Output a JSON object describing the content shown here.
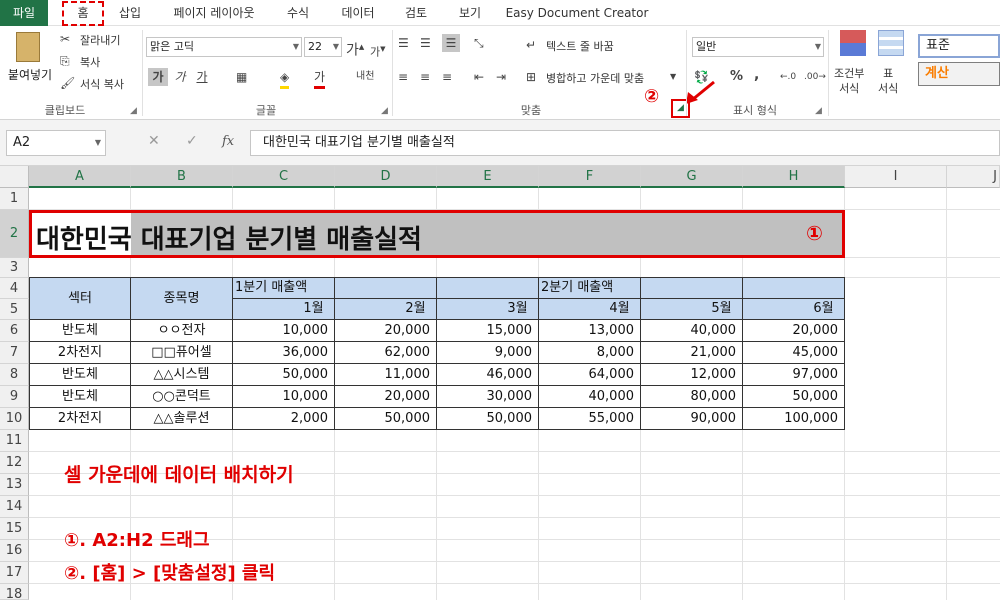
{
  "menu": {
    "tabs": [
      "파일",
      "홈",
      "삽입",
      "페이지 레이아웃",
      "수식",
      "데이터",
      "검토",
      "보기",
      "Easy Document Creator"
    ]
  },
  "ribbon": {
    "clipboard": {
      "paste": "붙여넣기",
      "cut": "잘라내기",
      "copy": "복사",
      "format_painter": "서식 복사",
      "label": "클립보드"
    },
    "font": {
      "name": "맑은 고딕",
      "size": "22",
      "bold": "가",
      "italic": "가",
      "underline": "가",
      "label": "글꼴",
      "font_color_icon": "가",
      "phonetic": "내천"
    },
    "alignment": {
      "wrap_text": "텍스트 줄 바꿈",
      "merge_center": "병합하고 가운데 맞춤",
      "label": "맞춤"
    },
    "number": {
      "format": "일반",
      "percent": "%",
      "comma": ",",
      "label": "표시 형식"
    },
    "styles": {
      "conditional": "조건부\n서식",
      "table": "표\n서식",
      "normal": "표준",
      "calc": "계산"
    },
    "marker_2": "②",
    "colors": {
      "accent": "#217346",
      "annotation": "#e00000",
      "header_fill": "#c5d9f1",
      "title_fill": "#c0c0c0"
    }
  },
  "formula_bar": {
    "name_box": "A2",
    "cancel": "✕",
    "enter": "✓",
    "fx": "fx",
    "value": "대한민국 대표기업 분기별 매출실적"
  },
  "sheet": {
    "columns": [
      "A",
      "B",
      "C",
      "D",
      "E",
      "F",
      "G",
      "H",
      "I",
      "J"
    ],
    "rows": [
      "1",
      "2",
      "3",
      "4",
      "5",
      "6",
      "7",
      "8",
      "9",
      "10",
      "11",
      "12",
      "13",
      "14",
      "15",
      "16",
      "17",
      "18"
    ],
    "title": "대한민국 대표기업 분기별 매출실적",
    "marker_1": "①",
    "header_row4": {
      "sector": "섹터",
      "name": "종목명",
      "q1": "1분기 매출액",
      "q2": "2분기 매출액"
    },
    "months": [
      "1월",
      "2월",
      "3월",
      "4월",
      "5월",
      "6월"
    ],
    "data": [
      {
        "sector": "반도체",
        "name": "ㅇㅇ전자",
        "values": [
          "10,000",
          "20,000",
          "15,000",
          "13,000",
          "40,000",
          "20,000"
        ]
      },
      {
        "sector": "2차전지",
        "name": "□□퓨어셀",
        "values": [
          "36,000",
          "62,000",
          "9,000",
          "8,000",
          "21,000",
          "45,000"
        ]
      },
      {
        "sector": "반도체",
        "name": "△△시스템",
        "values": [
          "50,000",
          "11,000",
          "46,000",
          "64,000",
          "12,000",
          "97,000"
        ]
      },
      {
        "sector": "반도체",
        "name": "○○콘덕트",
        "values": [
          "10,000",
          "20,000",
          "30,000",
          "40,000",
          "80,000",
          "50,000"
        ]
      },
      {
        "sector": "2차전지",
        "name": "△△솔루션",
        "values": [
          "2,000",
          "50,000",
          "50,000",
          "55,000",
          "90,000",
          "100,000"
        ]
      }
    ],
    "notes": {
      "heading": "셀 가운데에 데이터 배치하기",
      "step1": "①. A2:H2 드래그",
      "step2": "②. [홈] > [맞춤설정] 클릭"
    }
  }
}
